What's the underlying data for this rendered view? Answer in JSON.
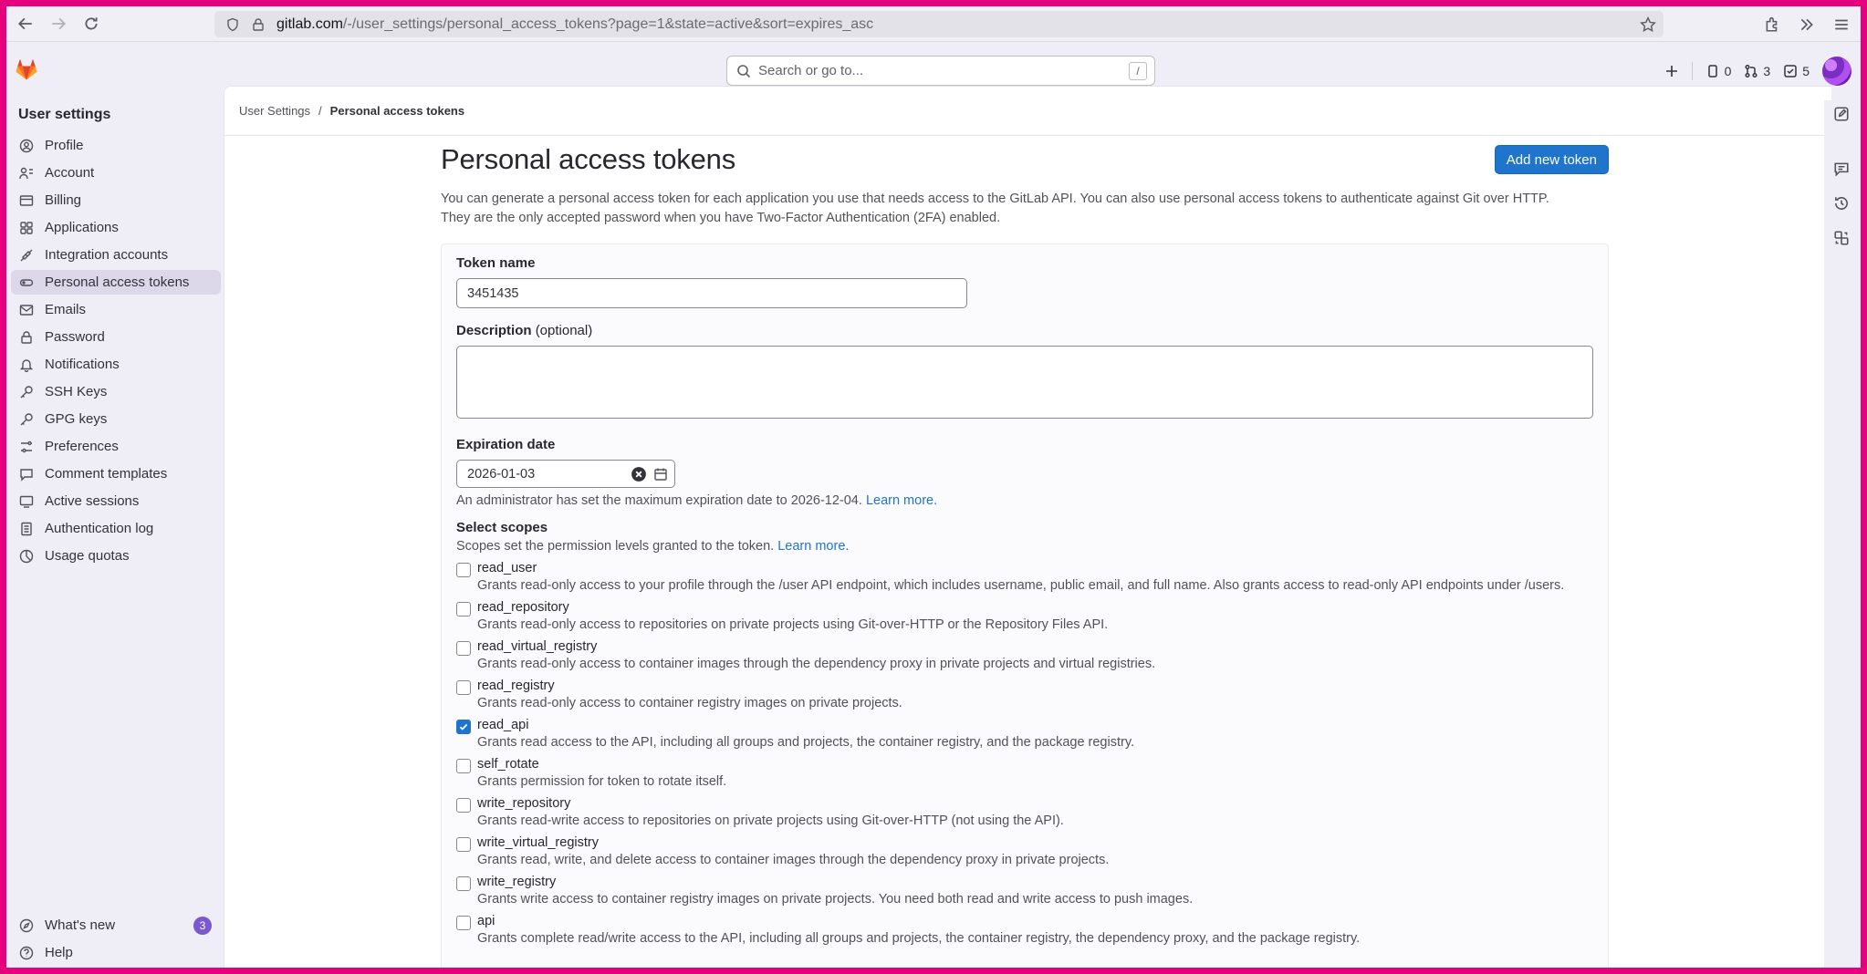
{
  "browser": {
    "url_host": "gitlab.com",
    "url_path": "/-/user_settings/personal_access_tokens?page=1&state=active&sort=expires_asc"
  },
  "topbar": {
    "search_placeholder": "Search or go to...",
    "search_shortcut": "/",
    "issues_count": "0",
    "mr_count": "3",
    "todo_count": "5"
  },
  "sidebar": {
    "title": "User settings",
    "items": [
      {
        "label": "Profile",
        "icon": "profile-icon"
      },
      {
        "label": "Account",
        "icon": "account-icon"
      },
      {
        "label": "Billing",
        "icon": "billing-icon"
      },
      {
        "label": "Applications",
        "icon": "applications-icon"
      },
      {
        "label": "Integration accounts",
        "icon": "integration-icon"
      },
      {
        "label": "Personal access tokens",
        "icon": "token-icon",
        "active": true
      },
      {
        "label": "Emails",
        "icon": "mail-icon"
      },
      {
        "label": "Password",
        "icon": "lock-icon"
      },
      {
        "label": "Notifications",
        "icon": "bell-icon"
      },
      {
        "label": "SSH Keys",
        "icon": "key-icon"
      },
      {
        "label": "GPG keys",
        "icon": "key-icon"
      },
      {
        "label": "Preferences",
        "icon": "preferences-icon"
      },
      {
        "label": "Comment templates",
        "icon": "comment-icon"
      },
      {
        "label": "Active sessions",
        "icon": "sessions-icon"
      },
      {
        "label": "Authentication log",
        "icon": "log-icon"
      },
      {
        "label": "Usage quotas",
        "icon": "quota-icon"
      }
    ],
    "whats_new": "What's new",
    "whats_new_badge": "3",
    "help": "Help"
  },
  "breadcrumb": {
    "parent": "User Settings",
    "current": "Personal access tokens"
  },
  "page": {
    "title": "Personal access tokens",
    "add_button": "Add new token",
    "intro_line1": "You can generate a personal access token for each application you use that needs access to the GitLab API. You can also use personal access tokens to authenticate against Git over HTTP.",
    "intro_line2": "They are the only accepted password when you have Two-Factor Authentication (2FA) enabled."
  },
  "form": {
    "token_name_label": "Token name",
    "token_name_value": "3451435",
    "description_label": "Description",
    "description_optional": "(optional)",
    "expiration_label": "Expiration date",
    "expiration_value": "2026-01-03",
    "expiration_help": "An administrator has set the maximum expiration date to 2026-12-04.",
    "expiration_learn_more": "Learn more.",
    "scopes_label": "Select scopes",
    "scopes_help": "Scopes set the permission levels granted to the token.",
    "scopes_learn_more": "Learn more.",
    "scopes": [
      {
        "name": "read_user",
        "checked": false,
        "desc": "Grants read-only access to your profile through the /user API endpoint, which includes username, public email, and full name. Also grants access to read-only API endpoints under /users."
      },
      {
        "name": "read_repository",
        "checked": false,
        "desc": "Grants read-only access to repositories on private projects using Git-over-HTTP or the Repository Files API."
      },
      {
        "name": "read_virtual_registry",
        "checked": false,
        "desc": "Grants read-only access to container images through the dependency proxy in private projects and virtual registries."
      },
      {
        "name": "read_registry",
        "checked": false,
        "desc": "Grants read-only access to container registry images on private projects."
      },
      {
        "name": "read_api",
        "checked": true,
        "desc": "Grants read access to the API, including all groups and projects, the container registry, and the package registry."
      },
      {
        "name": "self_rotate",
        "checked": false,
        "desc": "Grants permission for token to rotate itself."
      },
      {
        "name": "write_repository",
        "checked": false,
        "desc": "Grants read-write access to repositories on private projects using Git-over-HTTP (not using the API)."
      },
      {
        "name": "write_virtual_registry",
        "checked": false,
        "desc": "Grants read, write, and delete access to container images through the dependency proxy in private projects."
      },
      {
        "name": "write_registry",
        "checked": false,
        "desc": "Grants write access to container registry images on private projects. You need both read and write access to push images."
      },
      {
        "name": "api",
        "checked": false,
        "desc": "Grants complete read/write access to the API, including all groups and projects, the container registry, the dependency proxy, and the package registry."
      }
    ]
  }
}
